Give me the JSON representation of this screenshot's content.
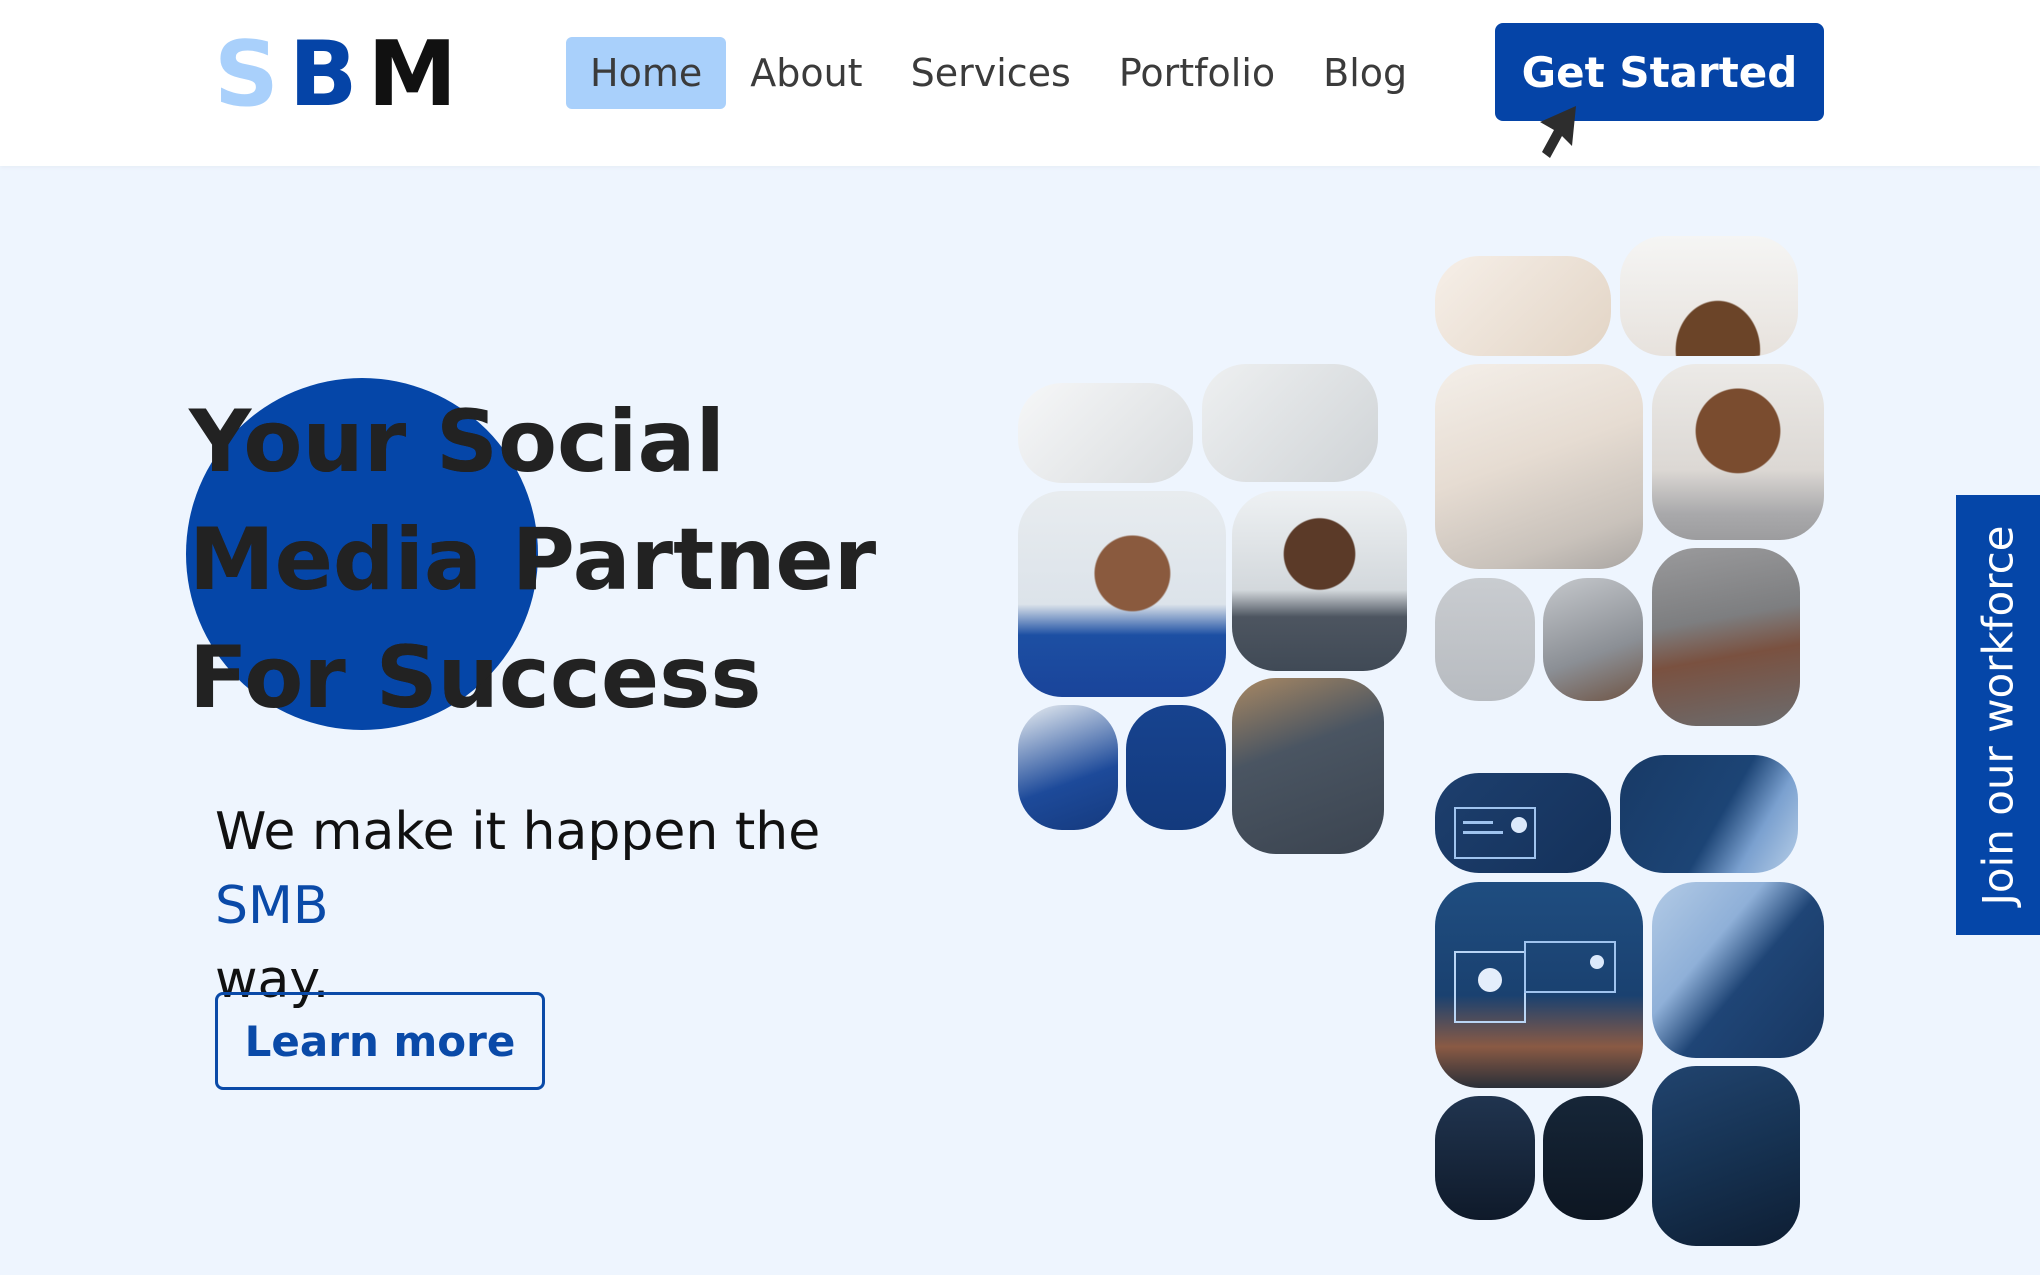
{
  "header": {
    "logo": [
      "S",
      "B",
      "M"
    ],
    "logo_colors": [
      "#a9d0fb",
      "#0544a7",
      "#111111"
    ],
    "nav": [
      "Home",
      "About",
      "Services",
      "Portfolio",
      "Blog"
    ],
    "active_nav": "Home",
    "cta_label": "Get Started"
  },
  "hero": {
    "title_lines": [
      "Your Social",
      "Media Partner",
      "For Success"
    ],
    "subtitle_before": "We make it happen the",
    "subtitle_accent": "SMB",
    "subtitle_after": "way.",
    "learn_more": "Learn more"
  },
  "side_tab": {
    "label": "Join our workforce"
  },
  "colors": {
    "brand_dark": "#0544a7",
    "brand_light": "#a9d0fb",
    "page_bg": "#eef5fe"
  }
}
